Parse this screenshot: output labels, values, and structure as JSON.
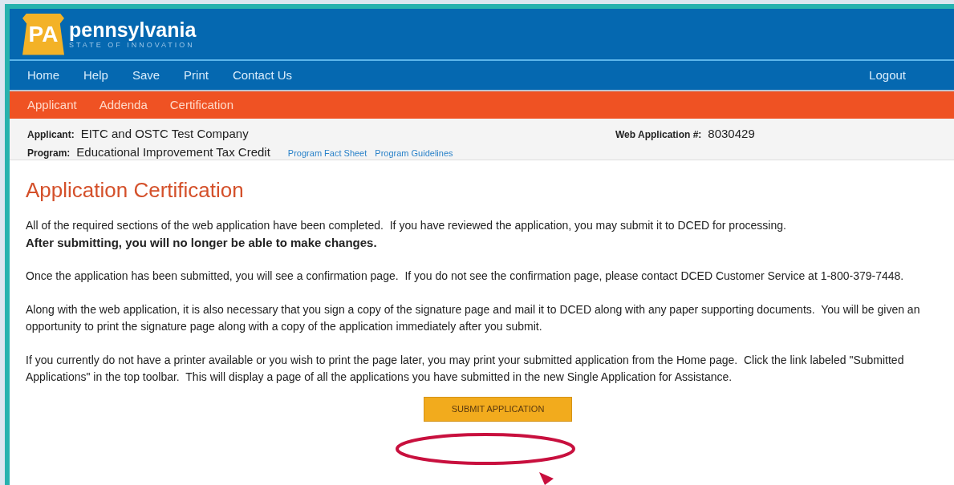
{
  "header": {
    "logo_mark": "PA",
    "logo_title": "pennsylvania",
    "logo_tagline": "STATE OF INNOVATION"
  },
  "nav": {
    "items": [
      "Home",
      "Help",
      "Save",
      "Print",
      "Contact Us"
    ],
    "logout": "Logout"
  },
  "tabs": [
    "Applicant",
    "Addenda",
    "Certification"
  ],
  "info": {
    "applicant_label": "Applicant:",
    "applicant": "EITC and OSTC Test Company",
    "program_label": "Program:",
    "program": "Educational Improvement Tax Credit",
    "links": [
      "Program Fact Sheet",
      "Program Guidelines"
    ],
    "web_app_label": "Web Application #:",
    "web_app_number": "8030429"
  },
  "content": {
    "title": "Application Certification",
    "paragraphs": [
      {
        "kind": "normal",
        "text": "All of the required sections of the web application have been completed.  If you have reviewed the application, you may submit it to DCED for processing."
      },
      {
        "kind": "bold",
        "text": "After submitting, you will no longer be able to make changes."
      },
      {
        "kind": "gap"
      },
      {
        "kind": "normal",
        "text": "Once the application has been submitted, you will see a confirmation page.  If you do not see the confirmation page, please contact DCED Customer Service at 1-800-379-7448."
      },
      {
        "kind": "gap"
      },
      {
        "kind": "normal",
        "text": "Along with the web application, it is also necessary that you sign a copy of the signature page and mail it to DCED along with any paper supporting documents.  You will be given an opportunity to print the signature page along with a copy of the application immediately after you submit."
      },
      {
        "kind": "gap"
      },
      {
        "kind": "normal",
        "text": "If you currently do not have a printer available or you wish to print the page later, you may print your submitted application from the Home page.  Click the link labeled \"Submitted Applications\" in the top toolbar.  This will display a page of all the applications you have submitted in the new Single Application for Assistance."
      }
    ],
    "submit_button": "SUBMIT APPLICATION"
  }
}
